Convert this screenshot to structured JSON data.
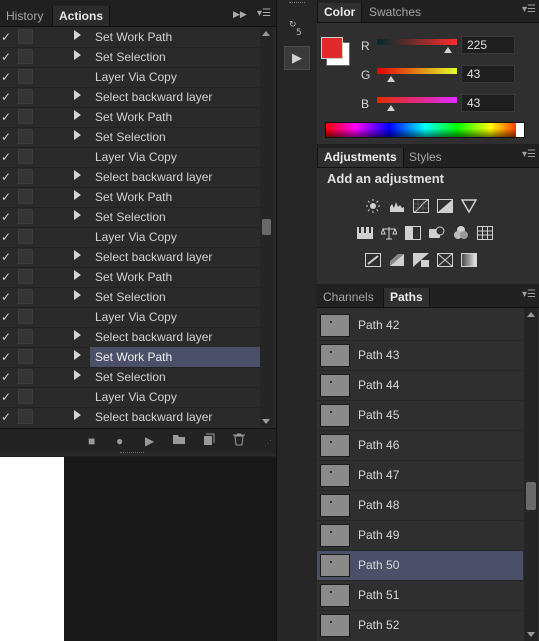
{
  "left_panel": {
    "tabs": [
      "History",
      "Actions"
    ],
    "actions": [
      {
        "label": "Set Work Path",
        "expandable": true,
        "selected": false
      },
      {
        "label": "Set Selection",
        "expandable": true,
        "selected": false
      },
      {
        "label": "Layer Via Copy",
        "expandable": false,
        "selected": false
      },
      {
        "label": "Select backward layer",
        "expandable": true,
        "selected": false
      },
      {
        "label": "Set Work Path",
        "expandable": true,
        "selected": false
      },
      {
        "label": "Set Selection",
        "expandable": true,
        "selected": false
      },
      {
        "label": "Layer Via Copy",
        "expandable": false,
        "selected": false
      },
      {
        "label": "Select backward layer",
        "expandable": true,
        "selected": false
      },
      {
        "label": "Set Work Path",
        "expandable": true,
        "selected": false
      },
      {
        "label": "Set Selection",
        "expandable": true,
        "selected": false
      },
      {
        "label": "Layer Via Copy",
        "expandable": false,
        "selected": false
      },
      {
        "label": "Select backward layer",
        "expandable": true,
        "selected": false
      },
      {
        "label": "Set Work Path",
        "expandable": true,
        "selected": false
      },
      {
        "label": "Set Selection",
        "expandable": true,
        "selected": false
      },
      {
        "label": "Layer Via Copy",
        "expandable": false,
        "selected": false
      },
      {
        "label": "Select backward layer",
        "expandable": true,
        "selected": false
      },
      {
        "label": "Set Work Path",
        "expandable": true,
        "selected": true
      },
      {
        "label": "Set Selection",
        "expandable": true,
        "selected": false
      },
      {
        "label": "Layer Via Copy",
        "expandable": false,
        "selected": false
      },
      {
        "label": "Select backward layer",
        "expandable": true,
        "selected": false
      }
    ],
    "scroll_position": 0.5
  },
  "color_panel": {
    "tabs": [
      "Color",
      "Swatches"
    ],
    "foreground_color": "#e12b2b",
    "channels": [
      {
        "label": "R",
        "value": "225",
        "fraction": 0.882
      },
      {
        "label": "G",
        "value": "43",
        "fraction": 0.169
      },
      {
        "label": "B",
        "value": "43",
        "fraction": 0.169
      }
    ]
  },
  "adjustments_panel": {
    "tabs": [
      "Adjustments",
      "Styles"
    ],
    "heading": "Add an adjustment",
    "icons": [
      "brightness-icon",
      "levels-icon",
      "curves-icon",
      "exposure-icon",
      "triangle-icon",
      "vibrance-icon",
      "balance-icon",
      "black-white-icon",
      "photo-filter-icon",
      "channel-mixer-icon",
      "color-lookup-icon",
      "invert-icon",
      "posterize-icon",
      "threshold-icon",
      "selective-color-icon",
      "gradient-map-icon"
    ]
  },
  "paths_panel": {
    "tabs": [
      "Channels",
      "Paths"
    ],
    "paths": [
      {
        "label": "Path 42",
        "selected": false
      },
      {
        "label": "Path 43",
        "selected": false
      },
      {
        "label": "Path 44",
        "selected": false
      },
      {
        "label": "Path 45",
        "selected": false
      },
      {
        "label": "Path 46",
        "selected": false
      },
      {
        "label": "Path 47",
        "selected": false
      },
      {
        "label": "Path 48",
        "selected": false
      },
      {
        "label": "Path 49",
        "selected": false
      },
      {
        "label": "Path 50",
        "selected": true
      },
      {
        "label": "Path 51",
        "selected": false
      },
      {
        "label": "Path 52",
        "selected": false
      }
    ],
    "scroll_position": 0.55
  }
}
